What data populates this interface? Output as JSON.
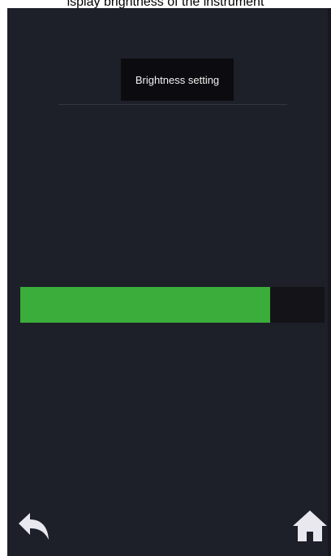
{
  "caption": {
    "text": "isplay brightness of the instrument"
  },
  "header": {
    "title": "Brightness setting"
  },
  "brightness": {
    "level": 0.82
  },
  "nav": {
    "back_icon": "back-arrow-icon",
    "home_icon": "home-icon"
  },
  "colors": {
    "screen_bg": "#1d1f29",
    "title_bg": "#0c0c10",
    "slider_fill": "#3aad3a",
    "slider_track": "#141418",
    "icon": "#e8e8ee"
  }
}
